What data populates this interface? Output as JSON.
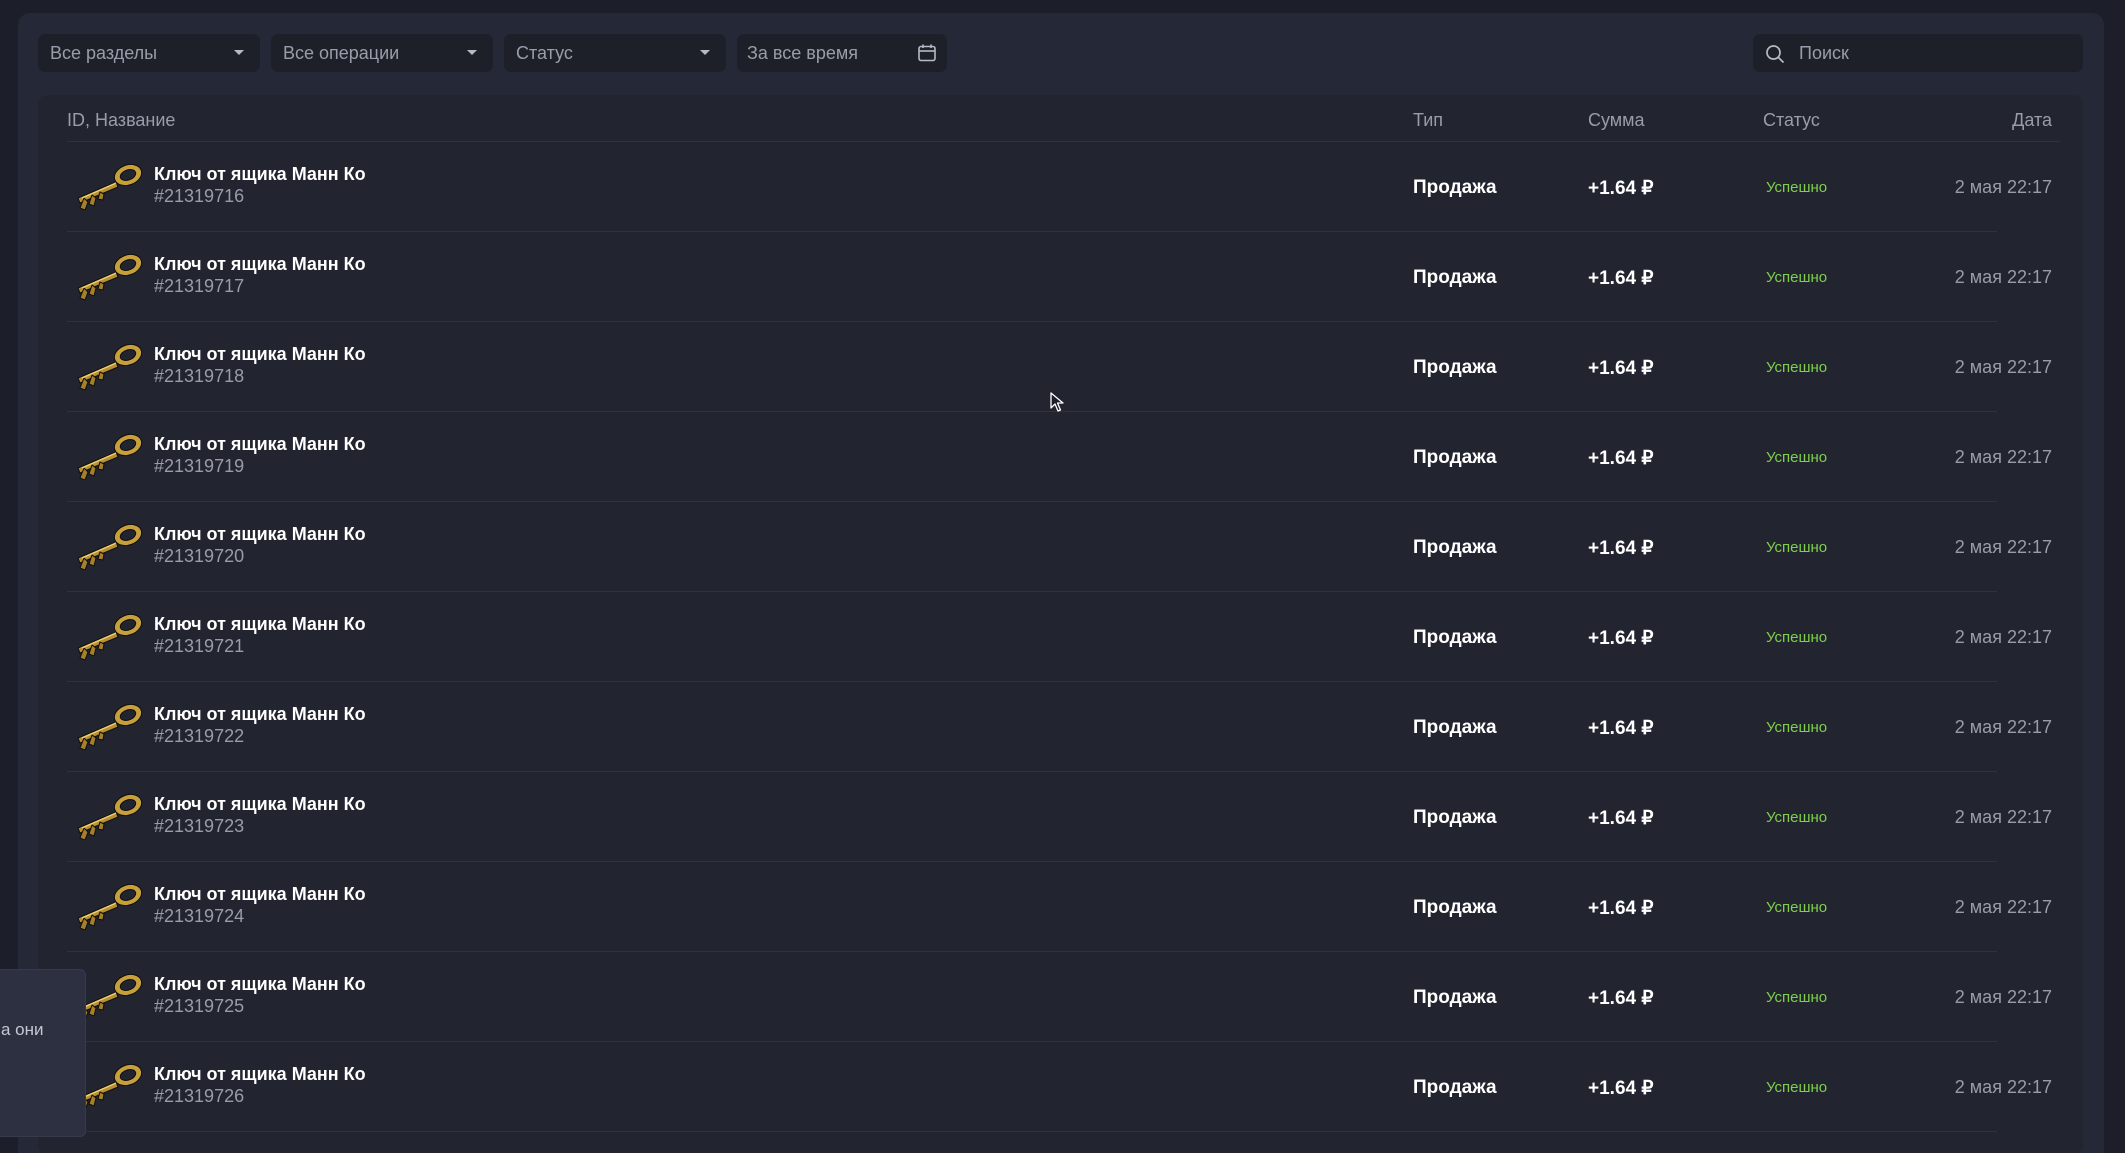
{
  "filters": {
    "section_label": "Все разделы",
    "operation_label": "Все операции",
    "status_label": "Статус",
    "period_label": "За все время",
    "search_placeholder": "Поиск"
  },
  "table": {
    "columns": {
      "name": "ID, Название",
      "type": "Тип",
      "sum": "Сумма",
      "status": "Статус",
      "date": "Дата"
    },
    "rows": [
      {
        "name": "Ключ от ящика Манн Ко",
        "id": "#21319716",
        "type": "Продажа",
        "sum": "+1.64 ₽",
        "status": "Успешно",
        "date": "2 мая 22:17"
      },
      {
        "name": "Ключ от ящика Манн Ко",
        "id": "#21319717",
        "type": "Продажа",
        "sum": "+1.64 ₽",
        "status": "Успешно",
        "date": "2 мая 22:17"
      },
      {
        "name": "Ключ от ящика Манн Ко",
        "id": "#21319718",
        "type": "Продажа",
        "sum": "+1.64 ₽",
        "status": "Успешно",
        "date": "2 мая 22:17"
      },
      {
        "name": "Ключ от ящика Манн Ко",
        "id": "#21319719",
        "type": "Продажа",
        "sum": "+1.64 ₽",
        "status": "Успешно",
        "date": "2 мая 22:17"
      },
      {
        "name": "Ключ от ящика Манн Ко",
        "id": "#21319720",
        "type": "Продажа",
        "sum": "+1.64 ₽",
        "status": "Успешно",
        "date": "2 мая 22:17"
      },
      {
        "name": "Ключ от ящика Манн Ко",
        "id": "#21319721",
        "type": "Продажа",
        "sum": "+1.64 ₽",
        "status": "Успешно",
        "date": "2 мая 22:17"
      },
      {
        "name": "Ключ от ящика Манн Ко",
        "id": "#21319722",
        "type": "Продажа",
        "sum": "+1.64 ₽",
        "status": "Успешно",
        "date": "2 мая 22:17"
      },
      {
        "name": "Ключ от ящика Манн Ко",
        "id": "#21319723",
        "type": "Продажа",
        "sum": "+1.64 ₽",
        "status": "Успешно",
        "date": "2 мая 22:17"
      },
      {
        "name": "Ключ от ящика Манн Ко",
        "id": "#21319724",
        "type": "Продажа",
        "sum": "+1.64 ₽",
        "status": "Успешно",
        "date": "2 мая 22:17"
      },
      {
        "name": "Ключ от ящика Манн Ко",
        "id": "#21319725",
        "type": "Продажа",
        "sum": "+1.64 ₽",
        "status": "Успешно",
        "date": "2 мая 22:17"
      },
      {
        "name": "Ключ от ящика Манн Ко",
        "id": "#21319726",
        "type": "Продажа",
        "sum": "+1.64 ₽",
        "status": "Успешно",
        "date": "2 мая 22:17"
      }
    ]
  },
  "tooltip": {
    "text": "а они"
  },
  "icons": {
    "row_icon": "key-icon",
    "dropdown": "chevron-down-icon",
    "calendar": "calendar-icon",
    "search": "search-icon",
    "pointer": "mouse-cursor-icon"
  },
  "colors": {
    "background": "#1c1e29",
    "panel": "#252836",
    "status_success": "#7fd04a",
    "muted_text": "#9a9caa"
  }
}
